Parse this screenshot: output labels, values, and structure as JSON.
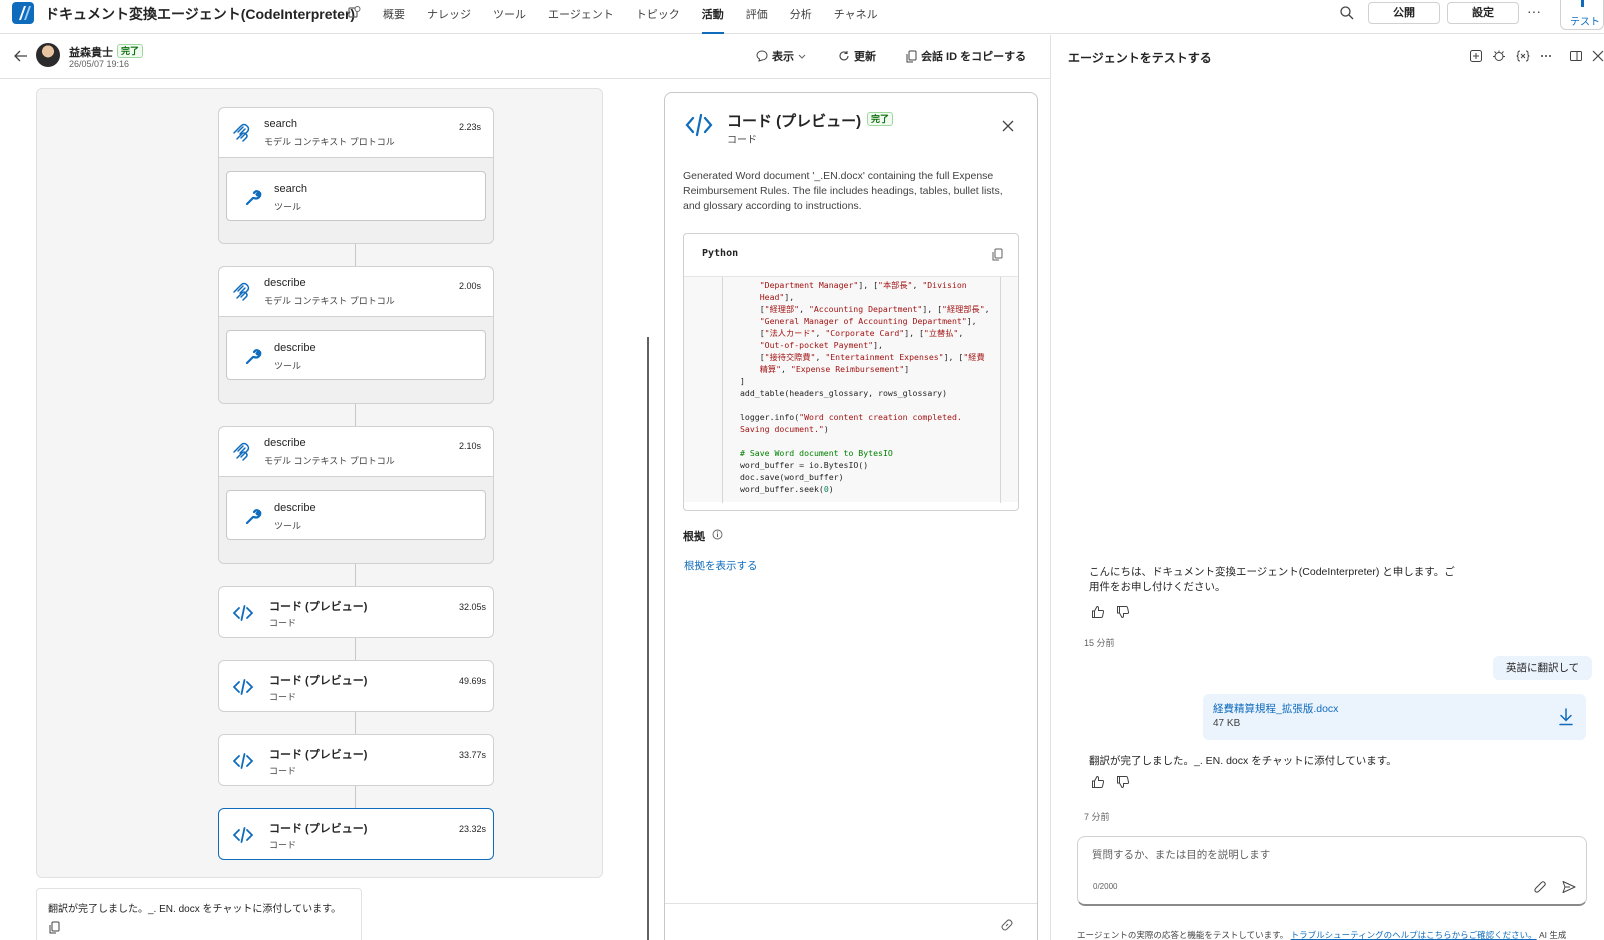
{
  "app": {
    "title": "ドキュメント変換エージェント(CodeInterpreter)",
    "tabs": [
      {
        "label": "概要",
        "active": false
      },
      {
        "label": "ナレッジ",
        "active": false
      },
      {
        "label": "ツール",
        "active": false
      },
      {
        "label": "エージェント",
        "active": false
      },
      {
        "label": "トピック",
        "active": false
      },
      {
        "label": "活動",
        "active": true
      },
      {
        "label": "評価",
        "active": false
      },
      {
        "label": "分析",
        "active": false
      },
      {
        "label": "チャネル",
        "active": false
      }
    ],
    "publish_label": "公開",
    "settings_label": "設定",
    "more_label": "···",
    "test_label": "テスト"
  },
  "activity": {
    "user_name": "益森貴士",
    "status": "完了",
    "timestamp": "26/05/07 19:16",
    "display_label": "表示",
    "refresh_label": "更新",
    "copy_id_label": "会話 ID をコピーする"
  },
  "flow": {
    "groups": [
      {
        "title": "search",
        "subtitle": "モデル コンテキスト プロトコル",
        "duration": "2.23s",
        "tool_title": "search",
        "tool_subtitle": "ツール"
      },
      {
        "title": "describe",
        "subtitle": "モデル コンテキスト プロトコル",
        "duration": "2.00s",
        "tool_title": "describe",
        "tool_subtitle": "ツール"
      },
      {
        "title": "describe",
        "subtitle": "モデル コンテキスト プロトコル",
        "duration": "2.10s",
        "tool_title": "describe",
        "tool_subtitle": "ツール"
      }
    ],
    "code_steps": [
      {
        "title": "コード (プレビュー)",
        "subtitle": "コード",
        "duration": "32.05s"
      },
      {
        "title": "コード (プレビュー)",
        "subtitle": "コード",
        "duration": "49.69s"
      },
      {
        "title": "コード (プレビュー)",
        "subtitle": "コード",
        "duration": "33.77s"
      },
      {
        "title": "コード (プレビュー)",
        "subtitle": "コード",
        "duration": "23.32s"
      }
    ],
    "footer_text": "翻訳が完了しました。_. EN. docx をチャットに添付しています。"
  },
  "detail": {
    "title": "コード (プレビュー)",
    "status": "完了",
    "subtitle": "コード",
    "description": "Generated Word document '_.EN.docx' containing the full Expense Reimbursement Rules. The file includes headings, tables, bullet lists, and glossary according to instructions.",
    "language": "Python",
    "grounds_title": "根拠",
    "grounds_link": "根拠を表示する"
  },
  "test_panel": {
    "title": "エージェントをテストする",
    "greeting": "こんにちは、ドキュメント変換エージェント(CodeInterpreter) と申します。ご用件をお申し付けください。",
    "greeting_time": "15 分前",
    "user_message": "英語に翻訳して",
    "file_name": "経費精算規程_拡張版.docx",
    "file_size": "47 KB",
    "reply": "翻訳が完了しました。_. EN. docx をチャットに添付しています。",
    "reply_time": "7 分前",
    "input_placeholder": "質問するか、または目的を説明します",
    "char_count": "0/2000",
    "disclaimer_prefix": "エージェントの実際の応答と機能をテストしています。",
    "disclaimer_link": "トラブルシューティングのヘルプはこちらからご確認ください。",
    "disclaimer_suffix": "AI 生成"
  },
  "colors": {
    "accent": "#0f6cbd",
    "success": "#0e700e",
    "user_bubble": "#ebf3fc"
  }
}
